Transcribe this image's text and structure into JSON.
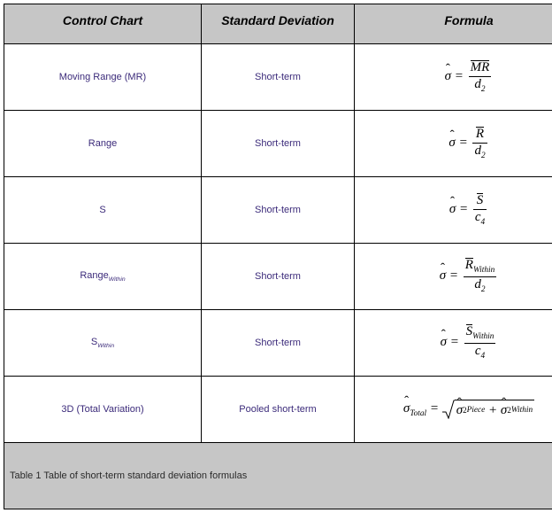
{
  "headers": {
    "col1": "Control Chart",
    "col2": "Standard Deviation",
    "col3": "Formula"
  },
  "rows": [
    {
      "label": "Moving Range (MR)",
      "label_sub": "",
      "deviation": "Short-term"
    },
    {
      "label": "Range",
      "label_sub": "",
      "deviation": "Short-term"
    },
    {
      "label": "S",
      "label_sub": "",
      "deviation": "Short-term"
    },
    {
      "label": "Range",
      "label_sub": "Within",
      "deviation": "Short-term"
    },
    {
      "label": "S",
      "label_sub": "Within",
      "deviation": "Short-term"
    },
    {
      "label": "3D (Total Variation)",
      "label_sub": "",
      "deviation": "Pooled short-term"
    }
  ],
  "formulas": {
    "mr": {
      "num": "MR",
      "den_base": "d",
      "den_sub": "2"
    },
    "range": {
      "num": "R",
      "den_base": "d",
      "den_sub": "2"
    },
    "s": {
      "num": "S",
      "den_base": "c",
      "den_sub": "4"
    },
    "range_within": {
      "num_base": "R",
      "num_sub": "Within",
      "den_base": "d",
      "den_sub": "2"
    },
    "s_within": {
      "num_base": "S",
      "num_sub": "Within",
      "den_base": "c",
      "den_sub": "4"
    },
    "total": {
      "lhs_sub": "Total",
      "term1_sub": "Piece",
      "term2_sub": "Within"
    }
  },
  "caption": "Table 1 Table of short-term standard deviation formulas",
  "chart_data": {
    "type": "table",
    "title": "Table 1 Table of short-term standard deviation formulas",
    "columns": [
      "Control Chart",
      "Standard Deviation",
      "Formula"
    ],
    "rows": [
      [
        "Moving Range (MR)",
        "Short-term",
        "sigma_hat = MR_bar / d2"
      ],
      [
        "Range",
        "Short-term",
        "sigma_hat = R_bar / d2"
      ],
      [
        "S",
        "Short-term",
        "sigma_hat = S_bar / c4"
      ],
      [
        "Range_Within",
        "Short-term",
        "sigma_hat = R_bar_Within / d2"
      ],
      [
        "S_Within",
        "Short-term",
        "sigma_hat = S_bar_Within / c4"
      ],
      [
        "3D (Total Variation)",
        "Pooled short-term",
        "sigma_hat_Total = sqrt( sigma_hat_Piece^2 + sigma_hat_Within^2 )"
      ]
    ]
  }
}
